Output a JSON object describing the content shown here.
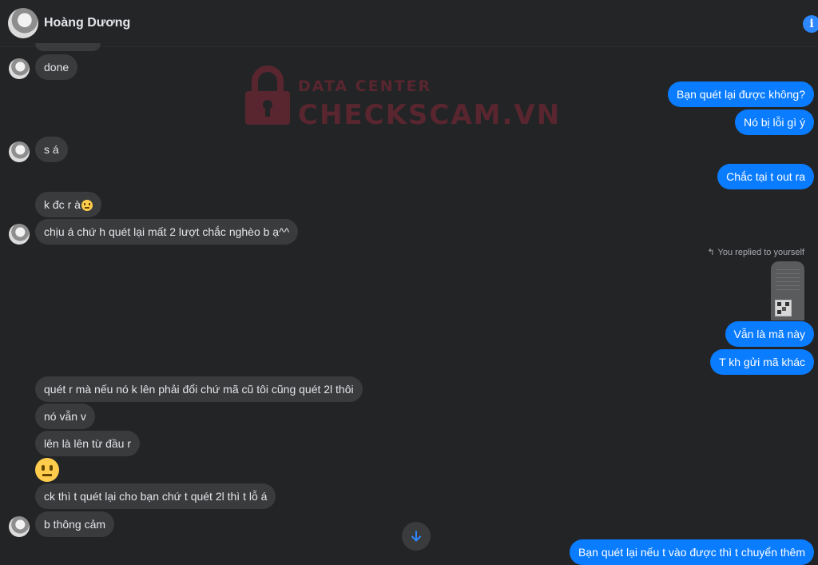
{
  "header": {
    "contact_name": "Hoàng Dương",
    "info_icon": "i"
  },
  "watermark": {
    "top": "DATA CENTER",
    "main": "CHECKSCAM.VN"
  },
  "messages": {
    "m1": "done",
    "m2": "Bạn quét lại được không?",
    "m3": "Nó bị lỗi gì ý",
    "m4": "s á",
    "m5": "Chắc tại t out ra",
    "m6": "k đc r à",
    "m7": "chịu á chứ h quét lại mất 2 lượt chắc nghèo b ạ^^",
    "m8": "Vẫn là mã này",
    "m9": "T kh gửi mã khác",
    "m10": "quét r mà nếu nó k lên phải đổi chứ mã cũ tôi cũng quét 2l thôi",
    "m11": "nó vẫn v",
    "m12": "lên là lên từ đầu r",
    "m13": "ck thì t quét lại cho bạn chứ t quét 2l thì t lỗ á",
    "m14": "b thông cảm",
    "m15": "Bạn quét lại nếu t vào được thì t chuyển thêm"
  },
  "reply_note": "You replied to yourself",
  "icons": {
    "info": "info-icon",
    "reply": "reply-arrow-icon",
    "scroll": "arrow-down-icon",
    "lock": "padlock-icon",
    "emoji": "neutral-face-emoji"
  },
  "colors": {
    "background": "#232426",
    "incoming_bubble": "#3a3b3c",
    "outgoing_bubble": "#0a7cff",
    "accent": "#2d88ff",
    "watermark": "#9b2a3c"
  }
}
